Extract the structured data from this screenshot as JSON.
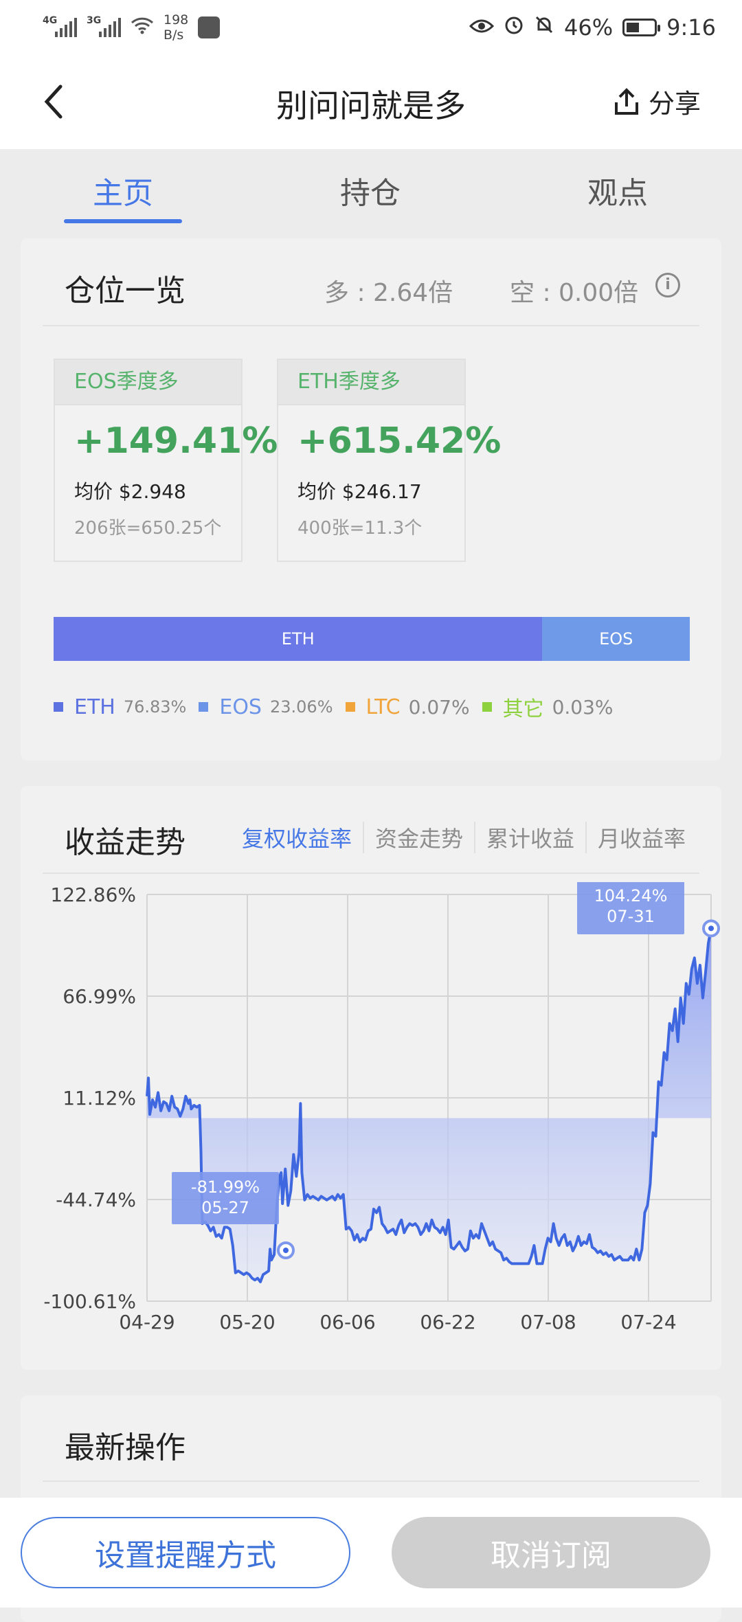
{
  "status_bar": {
    "sim1": "4G",
    "sim2": "3G",
    "net_speed_value": "198",
    "net_speed_unit": "B/s",
    "battery_level": "46%",
    "battery_fraction": 0.46,
    "time": "9:16"
  },
  "header": {
    "title": "别问问就是多",
    "share_label": "分享"
  },
  "tabs": [
    {
      "label": "主页",
      "active": true
    },
    {
      "label": "持仓",
      "active": false
    },
    {
      "label": "观点",
      "active": false
    }
  ],
  "overview": {
    "title": "仓位一览",
    "long_ratio": "多 : 2.64倍",
    "short_ratio": "空 : 0.00倍",
    "positions": [
      {
        "name": "EOS季度多",
        "pct": "+149.41%",
        "avg": "均价 $2.948",
        "qty": "206张=650.25个"
      },
      {
        "name": "ETH季度多",
        "pct": "+615.42%",
        "avg": "均价 $246.17",
        "qty": "400张=11.3个"
      }
    ],
    "allocation_bar": [
      {
        "label": "ETH",
        "fraction": 0.7683,
        "color": "#6b78e8"
      },
      {
        "label": "EOS",
        "fraction": 0.2317,
        "color": "#6e9ae8"
      }
    ],
    "legend": [
      {
        "label": "ETH",
        "pct": "76.83%",
        "color": "#5b72e0"
      },
      {
        "label": "EOS",
        "pct": "23.06%",
        "color": "#6b93e8"
      },
      {
        "label": "LTC",
        "pct": "0.07%",
        "color": "#f0a43a"
      },
      {
        "label": "其它",
        "pct": "0.03%",
        "color": "#8ed13f"
      }
    ]
  },
  "returns": {
    "title": "收益走势",
    "tabs": [
      {
        "label": "复权收益率",
        "active": true
      },
      {
        "label": "资金走势",
        "active": false
      },
      {
        "label": "累计收益",
        "active": false
      },
      {
        "label": "月收益率",
        "active": false
      }
    ]
  },
  "chart_data": {
    "type": "area",
    "x_ticks": [
      "04-29",
      "05-20",
      "06-06",
      "06-22",
      "07-08",
      "07-24"
    ],
    "y_ticks": [
      "122.86%",
      "66.99%",
      "11.12%",
      "-44.74%",
      "-100.61%"
    ],
    "ylim": [
      -100.61,
      122.86
    ],
    "xlim_days": [
      0,
      95
    ],
    "grid": true,
    "series": [
      {
        "color": "#3f68e0",
        "points": [
          [
            0,
            12
          ],
          [
            0.5,
            22
          ],
          [
            1,
            2
          ],
          [
            2,
            10
          ],
          [
            3,
            6
          ],
          [
            4,
            14
          ],
          [
            5,
            4
          ],
          [
            6,
            9
          ],
          [
            7,
            8
          ],
          [
            8,
            4
          ],
          [
            9,
            12
          ],
          [
            10,
            6
          ],
          [
            11,
            5
          ],
          [
            12,
            1
          ],
          [
            13,
            5
          ],
          [
            14,
            12
          ],
          [
            15,
            8
          ],
          [
            15.5,
            10
          ],
          [
            16,
            5
          ],
          [
            17,
            7
          ],
          [
            18,
            6
          ],
          [
            19,
            7
          ],
          [
            19.5,
            -18
          ],
          [
            20,
            -58
          ],
          [
            21,
            -57
          ],
          [
            22,
            -59
          ],
          [
            23,
            -62
          ],
          [
            24,
            -60
          ],
          [
            25,
            -65
          ],
          [
            26,
            -64
          ],
          [
            27,
            -66
          ],
          [
            28,
            -60
          ],
          [
            29,
            -60
          ],
          [
            30,
            -61
          ],
          [
            31,
            -70
          ],
          [
            32,
            -85
          ],
          [
            33,
            -84
          ],
          [
            34,
            -85
          ],
          [
            35,
            -86
          ],
          [
            36,
            -85
          ],
          [
            37,
            -86
          ],
          [
            38,
            -88
          ],
          [
            39,
            -89
          ],
          [
            40,
            -88
          ],
          [
            41,
            -90
          ],
          [
            42,
            -86
          ],
          [
            43,
            -85
          ],
          [
            44,
            -84
          ],
          [
            44.5,
            -72
          ],
          [
            45,
            -78
          ],
          [
            46,
            -75
          ],
          [
            47,
            -47
          ],
          [
            48,
            -32
          ],
          [
            48.5,
            -30
          ],
          [
            49,
            -47
          ],
          [
            50,
            -28
          ],
          [
            51,
            -48
          ],
          [
            52,
            -40
          ],
          [
            53,
            -20
          ],
          [
            54,
            -32
          ],
          [
            55,
            -19
          ],
          [
            55.5,
            8
          ],
          [
            56,
            -30
          ],
          [
            57,
            -45
          ],
          [
            58,
            -42
          ],
          [
            59,
            -44
          ],
          [
            60,
            -43
          ],
          [
            61,
            -44
          ],
          [
            62,
            -45
          ],
          [
            63,
            -43
          ],
          [
            64,
            -44
          ],
          [
            65,
            -45
          ],
          [
            66,
            -44
          ],
          [
            67,
            -43
          ],
          [
            68,
            -45
          ],
          [
            69,
            -42
          ],
          [
            70,
            -44
          ],
          [
            71,
            -42
          ],
          [
            72,
            -61
          ],
          [
            73,
            -60
          ],
          [
            74,
            -62
          ],
          [
            75,
            -67
          ],
          [
            76,
            -64
          ],
          [
            77,
            -68
          ],
          [
            78,
            -66
          ],
          [
            79,
            -67
          ],
          [
            80,
            -62
          ],
          [
            81,
            -61
          ],
          [
            82,
            -50
          ],
          [
            83,
            -52
          ],
          [
            84,
            -49
          ],
          [
            85,
            -58
          ],
          [
            86,
            -60
          ],
          [
            87,
            -63
          ],
          [
            88,
            -62
          ],
          [
            89,
            -61
          ],
          [
            90,
            -64
          ],
          [
            91,
            -59
          ],
          [
            92,
            -56
          ],
          [
            93,
            -63
          ],
          [
            94,
            -60
          ],
          [
            95,
            -58
          ],
          [
            96,
            -59
          ],
          [
            97,
            -58
          ],
          [
            98,
            -60
          ],
          [
            99,
            -64
          ],
          [
            100,
            -62
          ],
          [
            101,
            -58
          ],
          [
            102,
            -62
          ],
          [
            103,
            -56
          ],
          [
            104,
            -60
          ],
          [
            105,
            -61
          ],
          [
            106,
            -63
          ],
          [
            107,
            -60
          ],
          [
            108,
            -64
          ],
          [
            109,
            -56
          ],
          [
            110,
            -71
          ],
          [
            111,
            -72
          ],
          [
            112,
            -70
          ],
          [
            113,
            -68
          ],
          [
            114,
            -71
          ],
          [
            115,
            -73
          ],
          [
            116,
            -72
          ],
          [
            117,
            -62
          ],
          [
            118,
            -66
          ],
          [
            119,
            -64
          ],
          [
            120,
            -66
          ],
          [
            121,
            -58
          ],
          [
            122,
            -62
          ],
          [
            123,
            -66
          ],
          [
            124,
            -70
          ],
          [
            125,
            -68
          ],
          [
            126,
            -72
          ],
          [
            127,
            -73
          ],
          [
            128,
            -74
          ],
          [
            129,
            -78
          ],
          [
            130,
            -77
          ],
          [
            131,
            -79
          ],
          [
            132,
            -80
          ],
          [
            133,
            -80
          ],
          [
            134,
            -80
          ],
          [
            135,
            -80
          ],
          [
            136,
            -80
          ],
          [
            137,
            -80
          ],
          [
            138,
            -80
          ],
          [
            139,
            -76
          ],
          [
            140,
            -70
          ],
          [
            141,
            -80
          ],
          [
            142,
            -80
          ],
          [
            143,
            -80
          ],
          [
            144,
            -72
          ],
          [
            145,
            -66
          ],
          [
            146,
            -68
          ],
          [
            147,
            -58
          ],
          [
            148,
            -66
          ],
          [
            149,
            -70
          ],
          [
            150,
            -66
          ],
          [
            151,
            -64
          ],
          [
            152,
            -70
          ],
          [
            153,
            -68
          ],
          [
            154,
            -73
          ],
          [
            155,
            -70
          ],
          [
            156,
            -65
          ],
          [
            157,
            -70
          ],
          [
            158,
            -68
          ],
          [
            159,
            -69
          ],
          [
            160,
            -64
          ],
          [
            161,
            -71
          ],
          [
            162,
            -72
          ],
          [
            163,
            -74
          ],
          [
            164,
            -73
          ],
          [
            165,
            -75
          ],
          [
            166,
            -74
          ],
          [
            167,
            -76
          ],
          [
            168,
            -75
          ],
          [
            169,
            -78
          ],
          [
            170,
            -77
          ],
          [
            171,
            -76
          ],
          [
            172,
            -78
          ],
          [
            173,
            -78
          ],
          [
            174,
            -78
          ],
          [
            175,
            -76
          ],
          [
            176,
            -78
          ],
          [
            177,
            -72
          ],
          [
            178,
            -78
          ],
          [
            179,
            -72
          ],
          [
            180,
            -52
          ],
          [
            181,
            -48
          ],
          [
            182,
            -36
          ],
          [
            183,
            -8
          ],
          [
            184,
            -10
          ],
          [
            185,
            20
          ],
          [
            186,
            18
          ],
          [
            187,
            36
          ],
          [
            188,
            32
          ],
          [
            189,
            52
          ],
          [
            190,
            48
          ],
          [
            191,
            60
          ],
          [
            192,
            42
          ],
          [
            193,
            66
          ],
          [
            194,
            52
          ],
          [
            195,
            74
          ],
          [
            196,
            68
          ],
          [
            197,
            82
          ],
          [
            198,
            88
          ],
          [
            199,
            74
          ],
          [
            200,
            84
          ],
          [
            201,
            66
          ],
          [
            202,
            80
          ],
          [
            203,
            96
          ],
          [
            204,
            104.24
          ]
        ]
      }
    ],
    "highlights": [
      {
        "label": "-81.99%",
        "date": "05-27",
        "value": -81.99
      },
      {
        "label": "104.24%",
        "date": "07-31",
        "value": 104.24
      }
    ]
  },
  "latest_ops": {
    "title": "最新操作"
  },
  "actions": {
    "remind_label": "设置提醒方式",
    "unsubscribe_label": "取消订阅"
  }
}
